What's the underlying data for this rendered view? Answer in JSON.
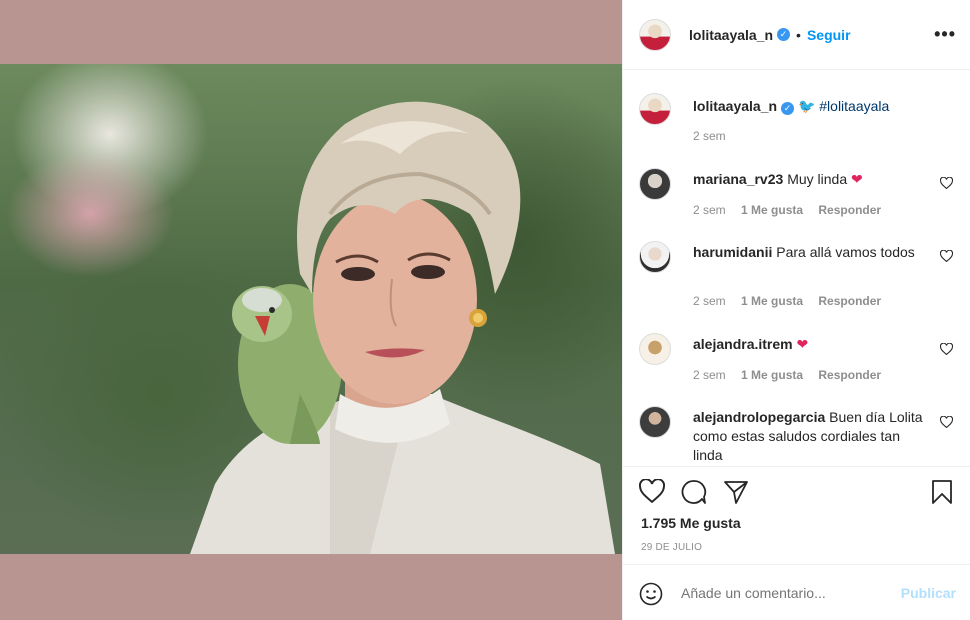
{
  "post": {
    "author": "lolitaayala_n",
    "follow_label": "Seguir",
    "dot": "•",
    "more_icon": "more-options-icon"
  },
  "caption": {
    "author": "lolitaayala_n",
    "emoji": "🐦",
    "hashtag": "#lolitaayala",
    "time": "2 sem"
  },
  "comments": [
    {
      "user": "mariana_rv23",
      "text": "Muy linda",
      "emoji": "❤",
      "time": "2 sem",
      "likes": "1 Me gusta",
      "reply": "Responder"
    },
    {
      "user": "harumidanii",
      "text": "Para allá vamos todos",
      "emoji": "",
      "time": "2 sem",
      "likes": "1 Me gusta",
      "reply": "Responder"
    },
    {
      "user": "alejandra.itrem",
      "text": "",
      "emoji": "❤",
      "time": "2 sem",
      "likes": "1 Me gusta",
      "reply": "Responder"
    },
    {
      "user": "alejandrolopegarcia",
      "text": "Buen día Lolita como estas saludos cordiales tan linda",
      "emoji": "",
      "time": "",
      "likes": "",
      "reply": ""
    }
  ],
  "stats": {
    "likes": "1.795 Me gusta",
    "date": "29 DE JULIO"
  },
  "composer": {
    "placeholder": "Añade un comentario...",
    "publish": "Publicar"
  },
  "colors": {
    "link": "#0095f6",
    "hashtag": "#00376b",
    "muted": "#8e8e8e",
    "frame": "#b89590"
  }
}
